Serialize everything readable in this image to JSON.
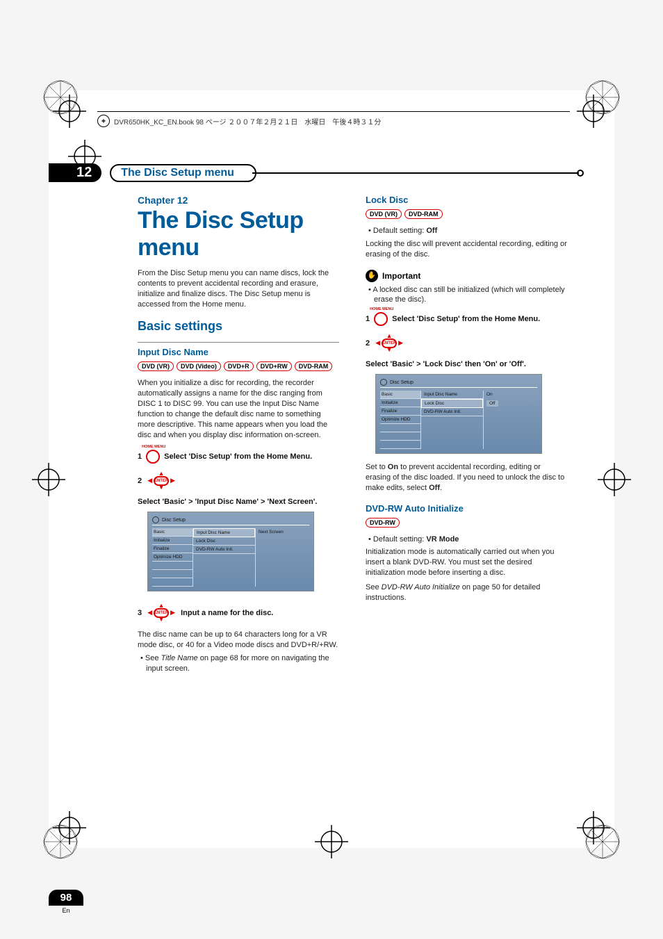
{
  "print_marker_text": "DVR650HK_KC_EN.book  98 ページ  ２００７年２月２１日　水曜日　午後４時３１分",
  "chapter_number": "12",
  "chapter_bar_label": "The Disc Setup menu",
  "chapter_label": "Chapter 12",
  "chapter_title": "The Disc Setup menu",
  "page_number": "98",
  "page_lang": "En",
  "left": {
    "intro": "From the Disc Setup menu you can name discs, lock the contents to prevent accidental recording and erasure, initialize and finalize discs. The Disc Setup menu is accessed from the Home menu.",
    "h2": "Basic settings",
    "h3_input": "Input Disc Name",
    "badges_input": [
      "DVD (VR)",
      "DVD (Video)",
      "DVD+R",
      "DVD+RW",
      "DVD-RAM"
    ],
    "para_input": "When you initialize a disc for recording, the recorder automatically assigns a name for the disc ranging from DISC 1 to DISC 99. You can use the Input Disc Name function to change the default disc name to something more descriptive. This name appears when you load the disc and when you display disc information on-screen.",
    "step1_num": "1",
    "step1_btn_label": "HOME MENU",
    "step1_text": "Select 'Disc Setup' from the Home Menu.",
    "step2_num": "2",
    "step2_enter": "ENTER",
    "step2_text": "Select 'Basic' > 'Input Disc Name' > 'Next Screen'.",
    "ui1": {
      "title": "Disc Setup",
      "side": [
        "Basic",
        "Initialize",
        "Finalize",
        "Optimize HDD"
      ],
      "mid": [
        "Input Disc Name",
        "Lock Disc",
        "DVD-RW Auto Init."
      ],
      "right": [
        "Next Screen"
      ]
    },
    "step3_num": "3",
    "step3_text": "Input a name for the disc.",
    "para_step3": "The disc name can be up to 64 characters long for a VR mode disc, or 40 for a Video mode discs and DVD+R/+RW.",
    "bullet3_pre": "See ",
    "bullet3_italic": "Title Name",
    "bullet3_post": " on page 68 for more on navigating the input screen."
  },
  "right": {
    "h3_lock": "Lock Disc",
    "badges_lock": [
      "DVD (VR)",
      "DVD-RAM"
    ],
    "bullet_default_lock_pre": "Default setting: ",
    "bullet_default_lock_val": "Off",
    "para_lock": "Locking the disc will prevent accidental recording, editing or erasing of the disc.",
    "important_label": "Important",
    "bullet_important": "A locked disc can still be initialized (which will completely erase the disc).",
    "step1_num": "1",
    "step1_btn_label": "HOME MENU",
    "step1_text": "Select 'Disc Setup' from the Home Menu.",
    "step2_num": "2",
    "step2_enter": "ENTER",
    "step2_text": "Select 'Basic' > 'Lock Disc' then 'On' or 'Off'.",
    "ui2": {
      "title": "Disc Setup",
      "side": [
        "Basic",
        "Initialize",
        "Finalize",
        "Optimize HDD"
      ],
      "mid": [
        "Input Disc Name",
        "Lock Disc",
        "DVD-RW Auto Init."
      ],
      "right": [
        "On",
        "Off"
      ]
    },
    "para_set_pre": "Set to ",
    "para_set_on": "On",
    "para_set_mid": " to prevent accidental recording, editing or erasing of the disc loaded. If you need to unlock the disc to make edits, select ",
    "para_set_off": "Off",
    "para_set_post": ".",
    "h3_auto": "DVD-RW Auto Initialize",
    "badges_auto": [
      "DVD-RW"
    ],
    "bullet_default_auto_pre": "Default setting: ",
    "bullet_default_auto_val": "VR Mode",
    "para_auto": "Initialization mode is automatically carried out when you insert a blank DVD-RW. You must set the desired initialization mode before inserting a disc.",
    "para_see_pre": "See ",
    "para_see_italic": "DVD-RW Auto Initialize",
    "para_see_post": " on page 50 for detailed instructions."
  }
}
